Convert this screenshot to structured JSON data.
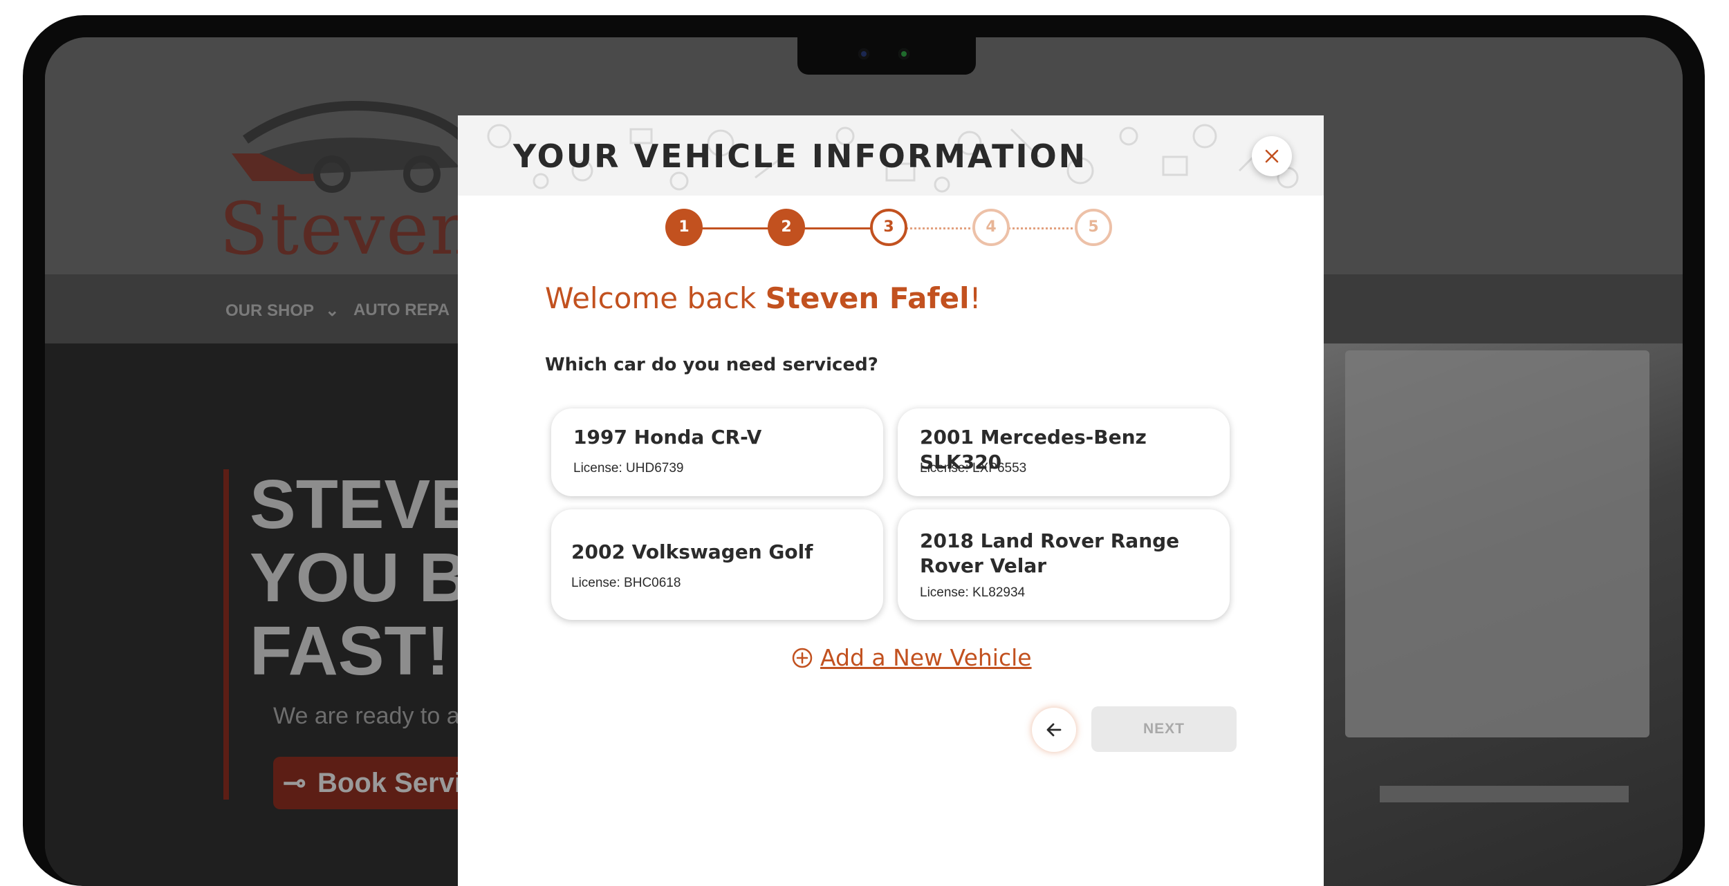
{
  "website": {
    "logo_text": "Steven Au",
    "nav": [
      "OUR SHOP",
      "AUTO REPA"
    ],
    "hero_title": "STEVE\nYOU B\nFAST!",
    "hero_sub": "We are ready to as",
    "book_button": "Book Servic"
  },
  "modal": {
    "title": "YOUR VEHICLE INFORMATION",
    "steps": [
      {
        "label": "1",
        "state": "done"
      },
      {
        "label": "2",
        "state": "done"
      },
      {
        "label": "3",
        "state": "current"
      },
      {
        "label": "4",
        "state": "todo"
      },
      {
        "label": "5",
        "state": "todo"
      }
    ],
    "welcome_prefix": "Welcome back ",
    "user_name": "Steven Fafel",
    "welcome_suffix": "!",
    "question": "Which car do you need serviced?",
    "vehicles": [
      {
        "name": "1997 Honda CR-V",
        "license": "License: UHD6739"
      },
      {
        "name": "2001 Mercedes-Benz SLK320",
        "license": "License: LXP6553"
      },
      {
        "name": "2002 Volkswagen Golf",
        "license": "License: BHC0618"
      },
      {
        "name": "2018 Land Rover Range Rover Velar",
        "license": "License: KL82934"
      }
    ],
    "add_vehicle": "Add a New Vehicle",
    "next_label": "NEXT"
  },
  "colors": {
    "accent": "#c2511f",
    "accent_light": "#edc1a8",
    "next_disabled_bg": "#e9e9e9"
  },
  "icons": {
    "close": "close-icon",
    "add": "plus-circle-icon",
    "back": "arrow-left-icon"
  }
}
